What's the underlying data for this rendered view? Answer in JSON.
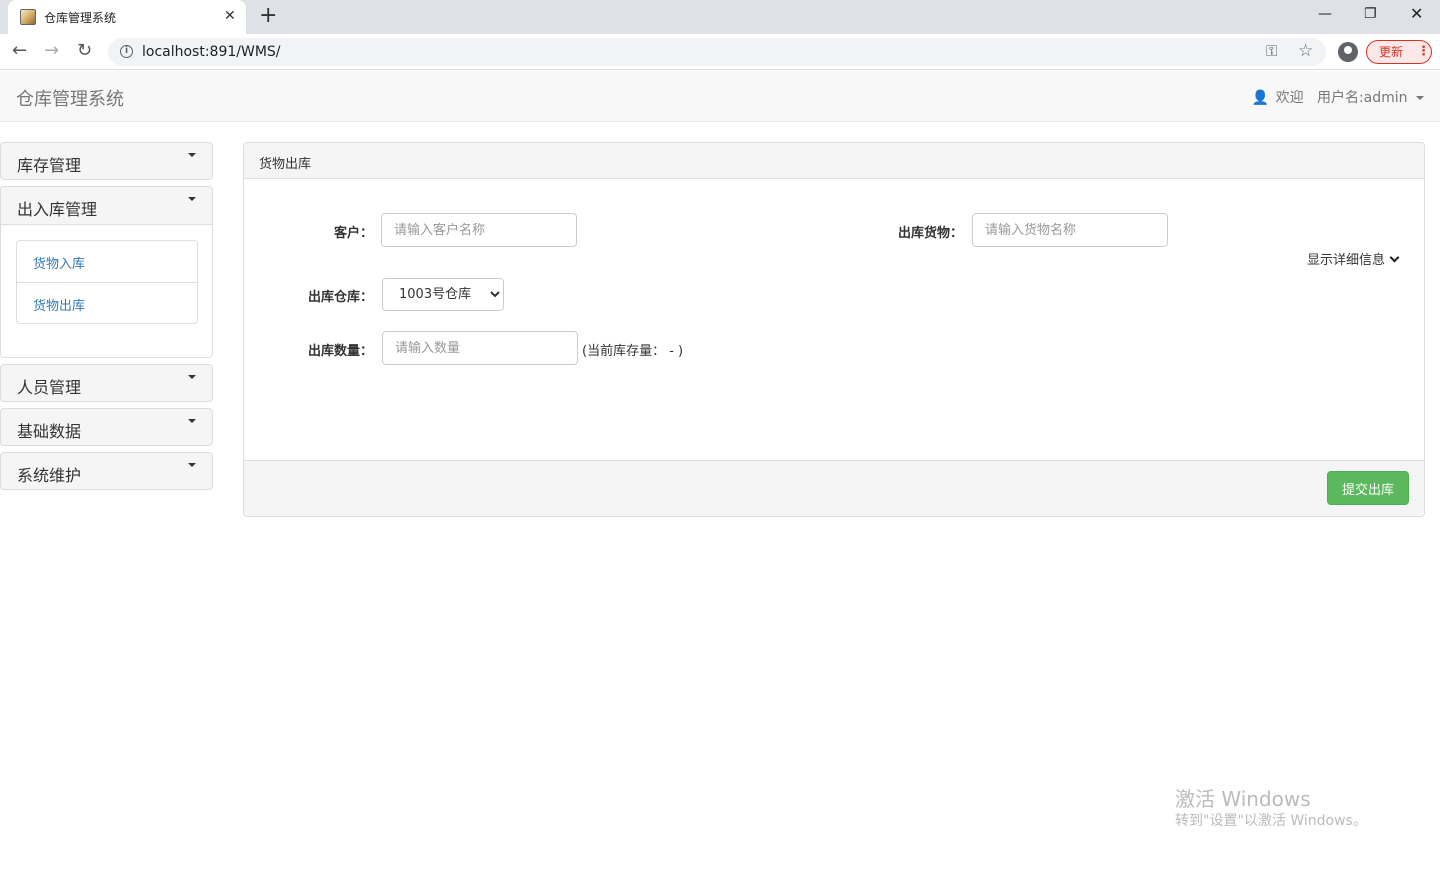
{
  "browser": {
    "tab_title": "仓库管理系统",
    "tab_close": "✕",
    "new_tab": "+",
    "url": "localhost:891/WMS/",
    "update_label": "更新",
    "win_min": "—",
    "win_max": "❐",
    "win_close": "✕"
  },
  "navbar": {
    "brand": "仓库管理系统",
    "welcome": "欢迎",
    "username": "用户名:admin"
  },
  "sidebar": {
    "sections": [
      {
        "label": "库存管理"
      },
      {
        "label": "出入库管理",
        "items": [
          "货物入库",
          "货物出库"
        ]
      },
      {
        "label": "人员管理"
      },
      {
        "label": "基础数据"
      },
      {
        "label": "系统维护"
      }
    ]
  },
  "main": {
    "panel_title": "货物出库",
    "customer_label": "客户：",
    "customer_placeholder": "请输入客户名称",
    "goods_label": "出库货物：",
    "goods_placeholder": "请输入货物名称",
    "detail_toggle": "显示详细信息",
    "warehouse_label": "出库仓库：",
    "warehouse_selected": "1003号仓库",
    "quantity_label": "出库数量：",
    "quantity_placeholder": "请输入数量",
    "stock_hint": "(当前库存量： - )",
    "submit_label": "提交出库"
  },
  "watermark": {
    "title": "激活 Windows",
    "subtitle": "转到\"设置\"以激活 Windows。"
  }
}
